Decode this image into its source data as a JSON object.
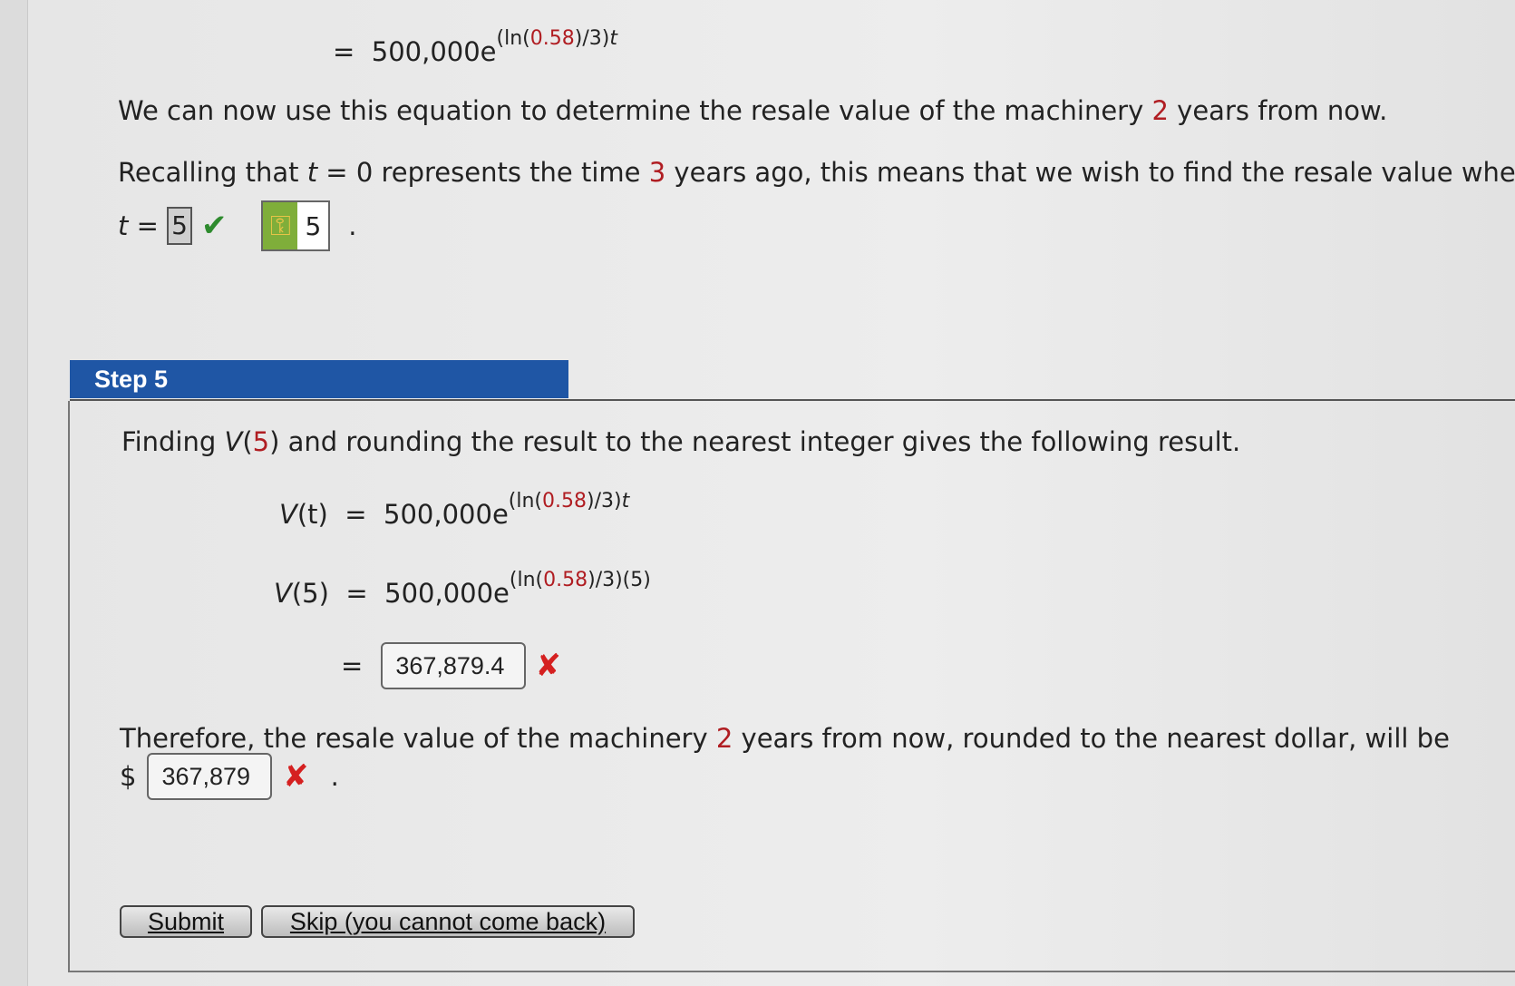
{
  "top_equation": {
    "equals": "=",
    "base": "500,000e",
    "exp_pre": "(ln(",
    "exp_val": "0.58",
    "exp_post": ")/3)",
    "exp_var": "t"
  },
  "para1": {
    "pre": "We can now use this equation to determine the resale value of the machinery",
    "num": "2",
    "post": "years from now."
  },
  "para2": {
    "pre": "Recalling that",
    "t": "t",
    "mid1": "= 0 represents the time",
    "num": "3",
    "post": "years ago, this means that we wish to find the resale value when"
  },
  "t_line": {
    "t": "t",
    "eq": "=",
    "answer": "5",
    "key_value": "5",
    "period": "."
  },
  "step": {
    "title": "Step 5"
  },
  "finding": {
    "pre": "Finding",
    "v": "V",
    "open": "(",
    "num": "5",
    "post": ") and rounding the result to the nearest integer gives the following result."
  },
  "eq1": {
    "lhs_v": "V",
    "lhs_arg": "(t)",
    "eq": "=",
    "base": "500,000e",
    "exp_pre": "(ln(",
    "exp_val": "0.58",
    "exp_post": ")/3)",
    "exp_var": "t"
  },
  "eq2": {
    "lhs_v": "V",
    "lhs_arg": "(5)",
    "eq": "=",
    "base": "500,000e",
    "exp_pre": "(ln(",
    "exp_val": "0.58",
    "exp_post": ")/3)(5)"
  },
  "eq3": {
    "eq": "=",
    "answer": "367,879.4"
  },
  "therefore": {
    "pre": "Therefore, the resale value of the machinery",
    "num": "2",
    "post": "years from now, rounded to the nearest dollar, will be"
  },
  "final": {
    "currency": "$",
    "answer": "367,879",
    "period": "."
  },
  "buttons": {
    "submit": "Submit",
    "skip": "Skip (you cannot come back)"
  },
  "icons": {
    "check": "checkmark-icon",
    "wrong": "x-mark-icon",
    "key": "key-icon"
  }
}
